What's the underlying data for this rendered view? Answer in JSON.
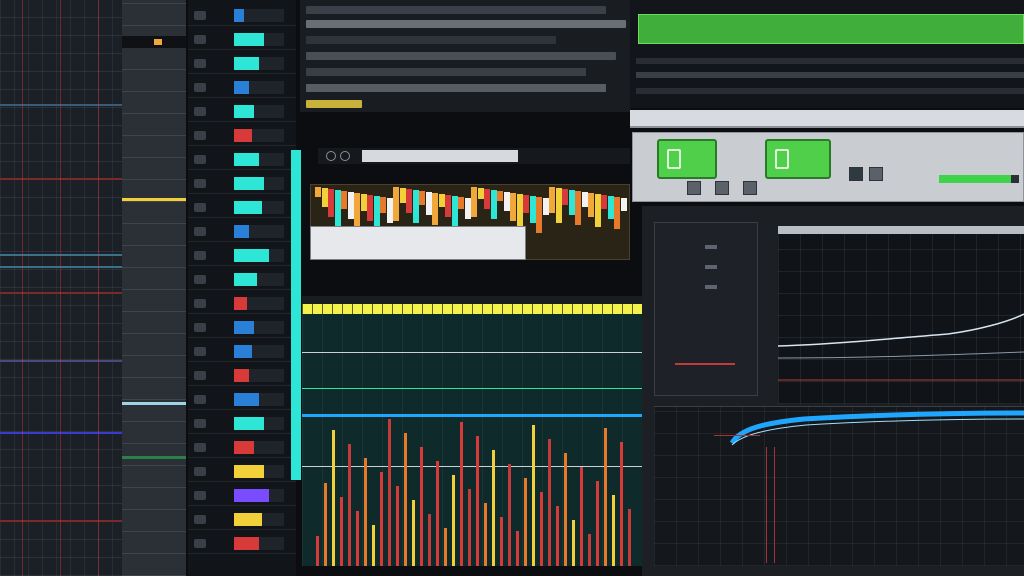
{
  "window": {
    "title": ""
  },
  "tracklist": {
    "rows": [
      {
        "name": "",
        "color": "#2a7fd6",
        "level": 0.2
      },
      {
        "name": "",
        "color": "#2ee6d6",
        "level": 0.6
      },
      {
        "name": "",
        "color": "#2ee6d6",
        "level": 0.5
      },
      {
        "name": "",
        "color": "#2a7fd6",
        "level": 0.3
      },
      {
        "name": "",
        "color": "#2ee6d6",
        "level": 0.4
      },
      {
        "name": "",
        "color": "#d83a3a",
        "level": 0.35
      },
      {
        "name": "",
        "color": "#2ee6d6",
        "level": 0.5
      },
      {
        "name": "",
        "color": "#2ee6d6",
        "level": 0.6
      },
      {
        "name": "",
        "color": "#2ee6d6",
        "level": 0.55
      },
      {
        "name": "",
        "color": "#2a7fd6",
        "level": 0.3
      },
      {
        "name": "",
        "color": "#2ee6d6",
        "level": 0.7
      },
      {
        "name": "",
        "color": "#2ee6d6",
        "level": 0.45
      },
      {
        "name": "",
        "color": "#d83a3a",
        "level": 0.25
      },
      {
        "name": "",
        "color": "#2a7fd6",
        "level": 0.4
      },
      {
        "name": "",
        "color": "#2a7fd6",
        "level": 0.35
      },
      {
        "name": "",
        "color": "#d83a3a",
        "level": 0.3
      },
      {
        "name": "",
        "color": "#2a7fd6",
        "level": 0.5
      },
      {
        "name": "",
        "color": "#2ee6d6",
        "level": 0.6
      },
      {
        "name": "",
        "color": "#d83a3a",
        "level": 0.4
      },
      {
        "name": "",
        "color": "#f2d03a",
        "level": 0.6
      },
      {
        "name": "",
        "color": "#7a4cff",
        "level": 0.7
      },
      {
        "name": "",
        "color": "#f2d03a",
        "level": 0.55
      },
      {
        "name": "",
        "color": "#d83a3a",
        "level": 0.5
      }
    ]
  },
  "pattern": {
    "title": "",
    "right_label": "",
    "lane_label": ""
  },
  "mixer": {
    "header_label": ""
  },
  "right": {
    "header_label": "",
    "bottom_label": ""
  },
  "toolbar": {
    "progress": 0.9
  },
  "colors": {
    "accent_green": "#3fae3a",
    "accent_cyan": "#2ee6d6",
    "accent_yellow": "#f2f24a",
    "accent_red": "#d83a3a",
    "accent_blue": "#1fa7ff"
  },
  "icons": {
    "toolbar_button_1": "clipboard-icon",
    "toolbar_button_2": "clipboard-icon"
  }
}
